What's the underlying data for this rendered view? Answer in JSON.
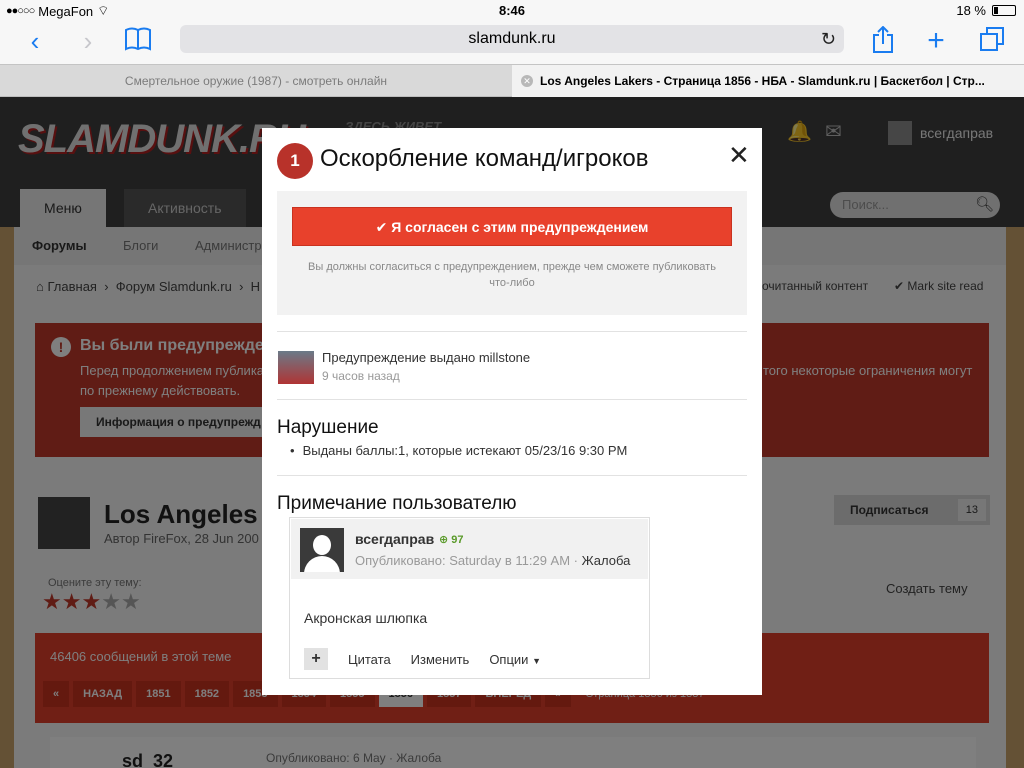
{
  "status_bar": {
    "carrier": "MegaFon",
    "time": "8:46",
    "battery": "18 %"
  },
  "browser": {
    "url": "slamdunk.ru",
    "tabs": [
      {
        "title": "Смертельное оружие (1987) - смотреть онлайн"
      },
      {
        "title": "Los Angeles Lakers - Страница 1856 - НБА - Slamdunk.ru | Баскетбол | Стр..."
      }
    ]
  },
  "site": {
    "logo": "SLAMDUNK.RU",
    "slogan": "ЗДЕСЬ ЖИВЕТ",
    "username": "всегдаправ",
    "nav_tabs": [
      "Меню",
      "Активность"
    ],
    "search_placeholder": "Поиск...",
    "subnav": [
      "Форумы",
      "Блоги",
      "Администр"
    ],
    "breadcrumb": [
      "Главная",
      "Форум Slamdunk.ru",
      "Н"
    ],
    "unread_link": "очитанный контент",
    "mark_read": "Mark site read",
    "warning": {
      "title": "Вы были предупрежде",
      "text_left": "Перед продолжением публика",
      "text_left2": "по прежнему действовать.",
      "text_right": "того некоторые ограничения могут",
      "button": "Информация о предупрежд"
    },
    "topic": {
      "title": "Los Angeles",
      "author_prefix": "Автор",
      "author": "FireFox",
      "date": ", 28 Jun 200",
      "subscribe": "Подписаться",
      "subscribers": "13",
      "rate_label": "Оцените эту тему:",
      "rating": 3,
      "create_topic": "Создать тему",
      "message_count": "46406 сообщений в этой теме"
    },
    "pager": {
      "first": "«",
      "prev": "НАЗАД",
      "pages": [
        "1851",
        "1852",
        "1853",
        "1854",
        "1855",
        "1856",
        "1857"
      ],
      "current": "1856",
      "next": "ВПЕРЕД",
      "last": "»",
      "total": "Страница 1856 из 1887"
    },
    "post": {
      "author": "sd_32",
      "published": "Опубликовано: 6 May",
      "report": "Жалоба"
    }
  },
  "modal": {
    "badge": "1",
    "title": "Оскорбление команд/игроков",
    "agree_button": "Я согласен с этим предупреждением",
    "agree_note": "Вы должны согласиться с предупреждением, прежде чем сможете публиковать что-либо",
    "issued_by": "Предупреждение выдано millstone",
    "issued_time": "9 часов назад",
    "violation_title": "Нарушение",
    "violation_item": "Выданы баллы:1, которые истекают 05/23/16 9:30 PM",
    "note_title": "Примечание пользователю",
    "note": {
      "user": "всегдаправ",
      "reputation": "97",
      "published": "Опубликовано: Saturday в 11:29 AM",
      "separator": "·",
      "report": "Жалоба",
      "text": "Акронская шлюпка",
      "plus": "+",
      "quote": "Цитата",
      "edit": "Изменить",
      "options": "Опции"
    }
  }
}
